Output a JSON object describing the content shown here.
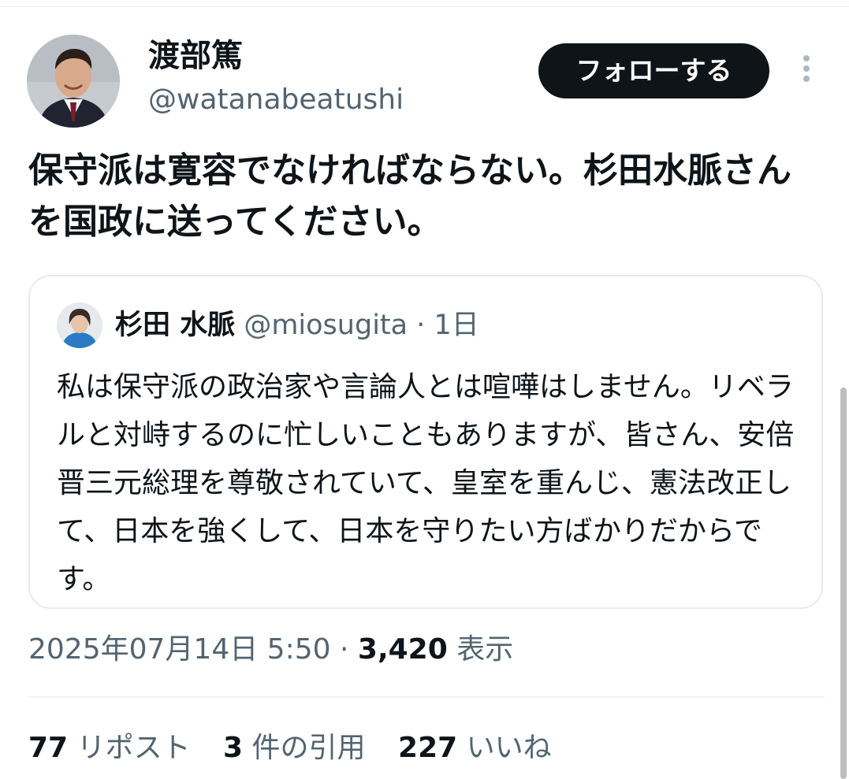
{
  "tweet": {
    "author": {
      "name": "渡部篤",
      "handle": "@watanabeatushi"
    },
    "follow_label": "フォローする",
    "more_icon": "more-vertical-icon",
    "text": "保守派は寛容でなければならない。杉田水脈さんを国政に送ってください。",
    "quote": {
      "author_name": "杉田 水脈",
      "handle": "@miosugita",
      "separator": "·",
      "time": "1日",
      "text": "私は保守派の政治家や言論人とは喧嘩はしません。リベラルと対峙するのに忙しいこともありますが、皆さん、安倍晋三元総理を尊敬されていて、皇室を重んじ、憲法改正して、日本を強くして、日本を守りたい方ばかりだからです。"
    },
    "timestamp": "2025年07月14日 5:50",
    "meta_separator": "·",
    "views_count": "3,420",
    "views_label": "表示",
    "stats": {
      "reposts_count": "77",
      "reposts_label": "リポスト",
      "quotes_count": "3",
      "quotes_label": "件の引用",
      "likes_count": "227",
      "likes_label": "いいね"
    }
  },
  "colors": {
    "primary_text": "#0f1419",
    "secondary_text": "#536471",
    "follow_button_bg": "#0f1419",
    "border": "#e8ebed"
  }
}
